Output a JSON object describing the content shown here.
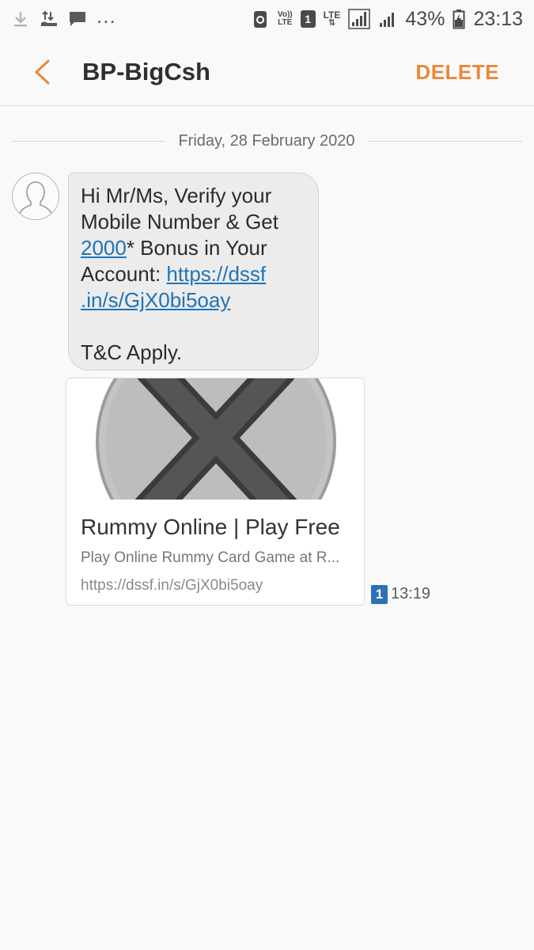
{
  "status_bar": {
    "dots": "...",
    "volte_top": "Vo))",
    "volte_bottom": "LTE",
    "sim_slot": "1",
    "lte_label": "LTE",
    "battery_percent": "43%",
    "clock": "23:13"
  },
  "app_bar": {
    "title": "BP-BigCsh",
    "delete_label": "DELETE"
  },
  "conversation": {
    "date": "Friday, 28 February 2020",
    "message": {
      "line1": "Hi Mr/Ms, Verify your",
      "line2": "Mobile Number & Get",
      "amount_link": "2000",
      "line3_rest": "* Bonus in  Your",
      "line4_prefix": "Account: ",
      "url_part1": "https://dssf",
      "url_part2": ".in/s/GjX0bi5oay",
      "line_tc": "T&C Apply."
    },
    "preview": {
      "title": "Rummy Online | Play Free",
      "description": "Play Online Rummy Card Game at R...",
      "url": "https://dssf.in/s/GjX0bi5oay"
    },
    "meta": {
      "sim_slot": "1",
      "time": "13:19"
    }
  },
  "colors": {
    "accent": "#e8893a",
    "link": "#1f73b7",
    "bubble": "#ececec",
    "sim_badge": "#2f6fb5"
  }
}
